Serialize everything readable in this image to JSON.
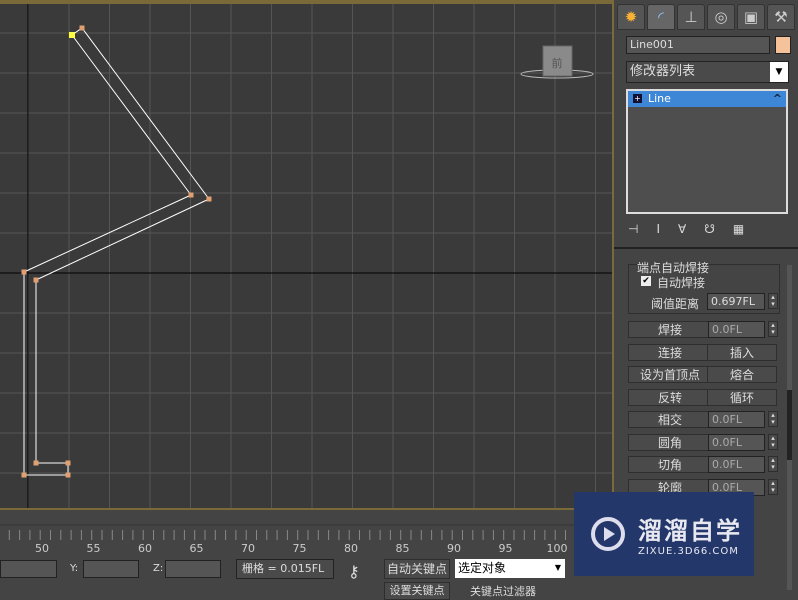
{
  "panel": {
    "tabs": [
      {
        "icon": "create-icon"
      },
      {
        "icon": "modify-icon"
      },
      {
        "icon": "hierarchy-icon"
      },
      {
        "icon": "motion-icon"
      },
      {
        "icon": "display-icon"
      },
      {
        "icon": "utilities-icon"
      }
    ],
    "object_name": "Line001",
    "object_color": "#f5c29a",
    "modifier_list": "修改器列表",
    "stack": [
      {
        "label": "Line",
        "selected": true
      }
    ],
    "rollout_title": "端点自动焊接",
    "auto_weld_label": "自动焊接",
    "auto_weld_checked": true,
    "threshold_label": "阈值距离",
    "threshold_value": "0.697FL",
    "rows": [
      {
        "button": "焊接",
        "value": "0.0FL"
      },
      {
        "button": "连接",
        "button2": "插入"
      },
      {
        "button": "设为首顶点",
        "button2": "熔合"
      },
      {
        "button": "反转",
        "button2": "循环"
      },
      {
        "button": "相交",
        "value": "0.0FL"
      },
      {
        "button": "圆角",
        "value": "0.0FL"
      },
      {
        "button": "切角",
        "value": "0.0FL"
      },
      {
        "button": "轮廓",
        "value": "0.0FL"
      }
    ]
  },
  "viewport": {
    "viewcube_label": "前"
  },
  "timeline": {
    "ticks": [
      "50",
      "55",
      "60",
      "65",
      "70",
      "75",
      "80",
      "85",
      "90",
      "95",
      "100"
    ]
  },
  "status": {
    "x_label": "X:",
    "y_label": "Y:",
    "z_label": "Z:",
    "x_value": "",
    "y_value": "",
    "z_value": "",
    "grid": "栅格 = 0.015FL",
    "auto_key": "自动关键点",
    "selection": "选定对象",
    "set_key": "设置关键点",
    "key_filters": "关键点过滤器"
  },
  "watermark": {
    "brand": "溜溜自学",
    "url": "ZIXUE.3D66.COM"
  }
}
